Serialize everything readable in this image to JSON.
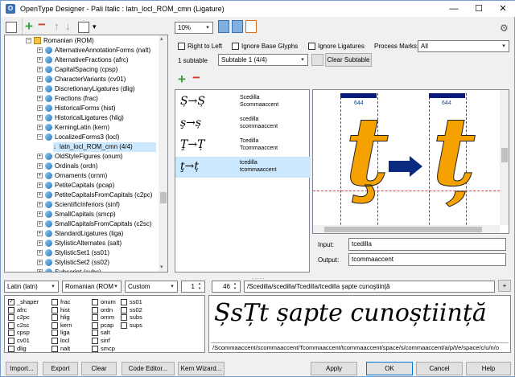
{
  "window": {
    "title": "OpenType Designer - Pali Italic : latn_locl_ROM_cmn (Ligature)",
    "minimize": "—",
    "maximize": "☐",
    "close": "✕"
  },
  "tree": {
    "root": "Romanian (ROM)",
    "items": [
      {
        "label": "AlternativeAnnotationForms (nalt)",
        "expanded": false
      },
      {
        "label": "AlternativeFractions (afrc)",
        "expanded": false
      },
      {
        "label": "CapitalSpacing (cpsp)",
        "expanded": false
      },
      {
        "label": "CharacterVariants (cv01)",
        "expanded": false
      },
      {
        "label": "DiscretionaryLigatures (dlig)",
        "expanded": false
      },
      {
        "label": "Fractions (frac)",
        "expanded": false
      },
      {
        "label": "HistoricalForms (hist)",
        "expanded": false
      },
      {
        "label": "HistoricalLigatures (hlig)",
        "expanded": false
      },
      {
        "label": "KerningLatin (kern)",
        "expanded": false
      },
      {
        "label": "LocalizedForms3 (locl)",
        "expanded": true
      },
      {
        "label": "latn_locl_ROM_cmn (4/4)",
        "child": true,
        "selected": true
      },
      {
        "label": "OldStyleFigures (onum)",
        "expanded": false
      },
      {
        "label": "Ordinals (ordn)",
        "expanded": false
      },
      {
        "label": "Ornaments (ornm)",
        "expanded": false
      },
      {
        "label": "PetiteCapitals (pcap)",
        "expanded": false
      },
      {
        "label": "PetiteCapitalsFromCapitals (c2pc)",
        "expanded": false
      },
      {
        "label": "ScientificInferiors (sinf)",
        "expanded": false
      },
      {
        "label": "SmallCapitals (smcp)",
        "expanded": false
      },
      {
        "label": "SmallCapitalsFromCapitals (c2sc)",
        "expanded": false
      },
      {
        "label": "StandardLigatures (liga)",
        "expanded": false
      },
      {
        "label": "StylisticAlternates (salt)",
        "expanded": false
      },
      {
        "label": "StylisticSet1 (ss01)",
        "expanded": false
      },
      {
        "label": "StylisticSet2 (ss02)",
        "expanded": false
      },
      {
        "label": "Subscript (subs)",
        "expanded": false
      }
    ]
  },
  "toolbar": {
    "zoom": "10%",
    "right_to_left": "Right to Left",
    "ignore_base_glyphs": "Ignore Base Glyphs",
    "ignore_ligatures": "Ignore Ligatures",
    "process_marks_label": "Process Marks:",
    "process_marks_value": "All",
    "subtable_count": "1 subtable",
    "subtable_value": "Subtable 1 (4/4)",
    "clear_subtable": "Clear Subtable"
  },
  "ligatures": [
    {
      "glyphs": "Ș→Ș",
      "input": "Scedilla",
      "output": "Scommaaccent"
    },
    {
      "glyphs": "ş→ș",
      "input": "scedilla",
      "output": "scommaaccent"
    },
    {
      "glyphs": "Ţ→Ț",
      "input": "Tcedilla",
      "output": "Tcommaaccent"
    },
    {
      "glyphs": "ţ→ț",
      "input": "tcedilla",
      "output": "tcommaaccent",
      "selected": true
    }
  ],
  "preview": {
    "left_glyph": "ţ",
    "right_glyph": "ț",
    "left_code": "644",
    "right_code": "644",
    "accent": "#f5a100",
    "arrow_color": "#0a2a80"
  },
  "io": {
    "input_label": "Input:",
    "input_value": "tcedilla",
    "output_label": "Output:",
    "output_value": "tcommaaccent"
  },
  "bottom": {
    "script": "Latin (latn)",
    "language": "Romanian (ROM",
    "mode": "Custom",
    "count": "1",
    "size": "46",
    "text": "/Scedilla/scedilla/Tcedilla/tcedilla şapte cunoştiinţă",
    "plus": "+",
    "preview_text": "ȘsȚt șapte cunoștiință",
    "glyph_names": "/Scommaaccent/scommaaccent/Tcommaaccent/tcommaaccent/space/s/commaaccent/a/p/t/e/space/c/u/n/o"
  },
  "features": [
    {
      "label": "_shaper",
      "checked": true
    },
    {
      "label": "afrc",
      "checked": false
    },
    {
      "label": "c2pc",
      "checked": false
    },
    {
      "label": "c2sc",
      "checked": false
    },
    {
      "label": "cpsp",
      "checked": false
    },
    {
      "label": "cv01",
      "checked": false
    },
    {
      "label": "dlig",
      "checked": false
    },
    {
      "label": "frac",
      "checked": false
    },
    {
      "label": "hist",
      "checked": false
    },
    {
      "label": "hlig",
      "checked": false
    },
    {
      "label": "kern",
      "checked": false
    },
    {
      "label": "liga",
      "checked": false
    },
    {
      "label": "locl",
      "checked": false
    },
    {
      "label": "nalt",
      "checked": false
    },
    {
      "label": "onum",
      "checked": false
    },
    {
      "label": "ordn",
      "checked": false
    },
    {
      "label": "ornm",
      "checked": false
    },
    {
      "label": "pcap",
      "checked": false
    },
    {
      "label": "salt",
      "checked": false
    },
    {
      "label": "sinf",
      "checked": false
    },
    {
      "label": "smcp",
      "checked": false
    },
    {
      "label": "ss01",
      "checked": false
    },
    {
      "label": "ss02",
      "checked": false
    },
    {
      "label": "subs",
      "checked": false
    },
    {
      "label": "sups",
      "checked": false
    }
  ],
  "buttons": {
    "import": "Import...",
    "export": "Export",
    "clear": "Clear",
    "code_editor": "Code Editor...",
    "kern_wizard": "Kern Wizard...",
    "apply": "Apply",
    "ok": "OK",
    "cancel": "Cancel",
    "help": "Help"
  }
}
